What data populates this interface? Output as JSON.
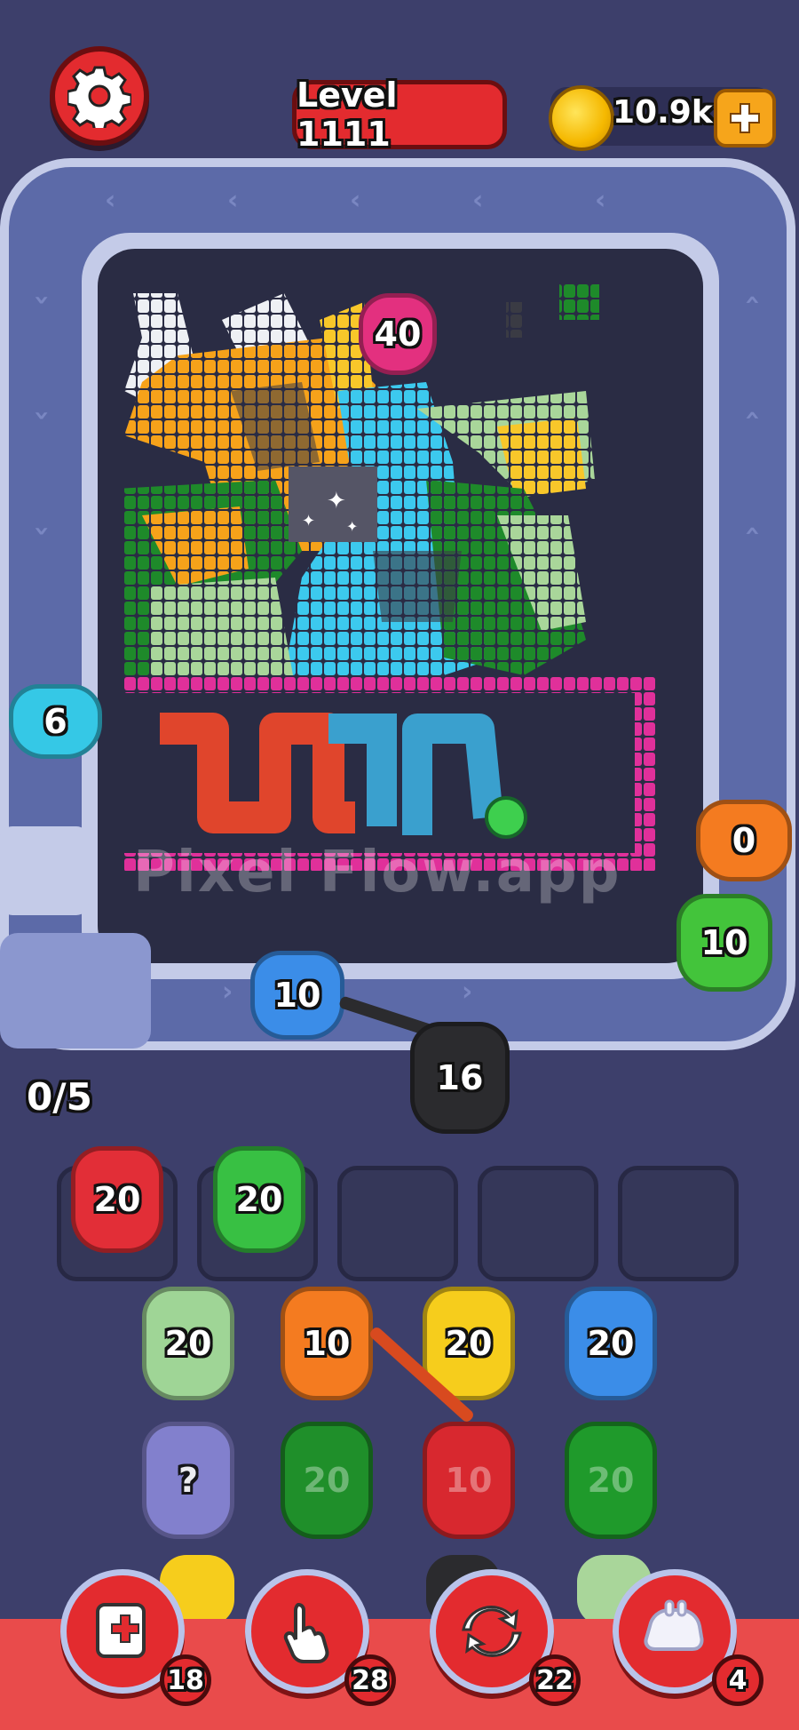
{
  "header": {
    "level_label": "Level 1111",
    "coins": "10.9k"
  },
  "board": {
    "watermark": "Pixel Flow.app",
    "sparkle": "✦"
  },
  "conveyor": {
    "progress": "0/5",
    "critters": [
      {
        "value": "40",
        "color": "#e3307f"
      },
      {
        "value": "6",
        "color": "#35c8e6"
      },
      {
        "value": "0",
        "color": "#f47b20"
      },
      {
        "value": "10",
        "color": "#43c43b"
      },
      {
        "value": "10",
        "color": "#3b8de8"
      },
      {
        "value": "16",
        "color": "#2b2b2e"
      }
    ]
  },
  "slots": {
    "filled": [
      {
        "value": "20",
        "color": "#e22e37"
      },
      {
        "value": "20",
        "color": "#38c043"
      }
    ]
  },
  "queue": {
    "row1": [
      {
        "value": "20",
        "color": "#9fd596"
      },
      {
        "value": "10",
        "color": "#f47b20"
      },
      {
        "value": "20",
        "color": "#f6cd1c"
      },
      {
        "value": "20",
        "color": "#3b8de8"
      }
    ],
    "row2": [
      {
        "value": "?",
        "color": "#8a88d8"
      },
      {
        "value": "20",
        "color": "#1f8f2a"
      },
      {
        "value": "10",
        "color": "#d8282f"
      },
      {
        "value": "20",
        "color": "#1f9a2b"
      }
    ]
  },
  "powerups": [
    {
      "name": "add-slot",
      "count": "18"
    },
    {
      "name": "hand-pick",
      "count": "28"
    },
    {
      "name": "shuffle",
      "count": "22"
    },
    {
      "name": "ghost",
      "count": "4"
    }
  ],
  "colors": {
    "accent": "#e32b2f",
    "board": "#2a2c44",
    "track": "#5c6aa8"
  }
}
